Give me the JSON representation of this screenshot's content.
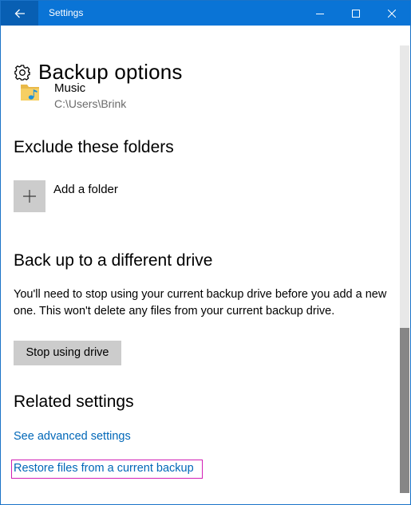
{
  "window": {
    "title": "Settings",
    "controls": {
      "minimize": "minimize",
      "maximize": "maximize",
      "close": "close"
    },
    "accent_color": "#0a74d6"
  },
  "page": {
    "title": "Backup options",
    "icon": "gear-icon"
  },
  "folders": [
    {
      "name": "Music",
      "path": "C:\\Users\\Brink",
      "icon": "music-folder-icon"
    }
  ],
  "exclude": {
    "title": "Exclude these folders",
    "add_label": "Add a folder"
  },
  "different_drive": {
    "title": "Back up to a different drive",
    "description": "You'll need to stop using your current backup drive before you add a new one. This won't delete any files from your current backup drive.",
    "button_label": "Stop using drive"
  },
  "related": {
    "title": "Related settings",
    "links": [
      {
        "label": "See advanced settings"
      },
      {
        "label": "Restore files from a current backup",
        "highlighted": true
      }
    ],
    "link_color": "#0067b8",
    "highlight_color": "#d21fb5"
  }
}
